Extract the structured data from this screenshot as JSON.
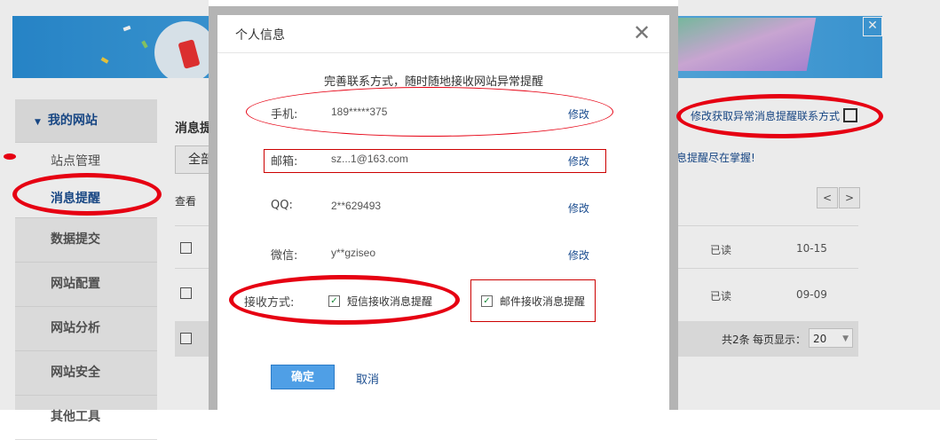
{
  "colors": {
    "accent_blue": "#1a4c8f",
    "annotation_red": "#e60012",
    "confirm_blue": "#4f9fe6",
    "check_green": "#1a8a3a"
  },
  "banner": {
    "close_icon": "close-icon"
  },
  "sidebar": {
    "section_title": "我的网站",
    "sub_items": [
      {
        "label": "站点管理"
      },
      {
        "label": "消息提醒"
      }
    ],
    "items": [
      {
        "label": "数据提交"
      },
      {
        "label": "网站配置"
      },
      {
        "label": "网站分析"
      },
      {
        "label": "网站安全"
      },
      {
        "label": "其他工具"
      }
    ]
  },
  "main": {
    "title": "消息提",
    "filter_label": "全部",
    "view_label": "查看",
    "edit_contact_link": "修改获取异常消息提醒联系方式",
    "notify_text": "息提醒尽在掌握!",
    "pager_prev": "<",
    "pager_next": ">",
    "rows": [
      {
        "status": "已读",
        "date": "10-15"
      },
      {
        "status": "已读",
        "date": "09-09"
      }
    ],
    "total_text": "共2条",
    "per_page_label": "每页显示：",
    "per_page_value": "20"
  },
  "modal": {
    "title": "个人信息",
    "tip": "完善联系方式，随时随地接收网站异常提醒",
    "fields": [
      {
        "label": "手机:",
        "value": "189*****375",
        "link": "修改"
      },
      {
        "label": "邮箱:",
        "value": "sz...1@163.com",
        "link": "修改"
      },
      {
        "label": "QQ:",
        "value": "2**629493",
        "link": "修改"
      },
      {
        "label": "微信:",
        "value": "y**gziseo",
        "link": "修改"
      }
    ],
    "receive_label": "接收方式:",
    "options": [
      {
        "label": "短信接收消息提醒",
        "checked": true
      },
      {
        "label": "邮件接收消息提醒",
        "checked": true
      }
    ],
    "confirm": "确定",
    "cancel": "取消"
  }
}
